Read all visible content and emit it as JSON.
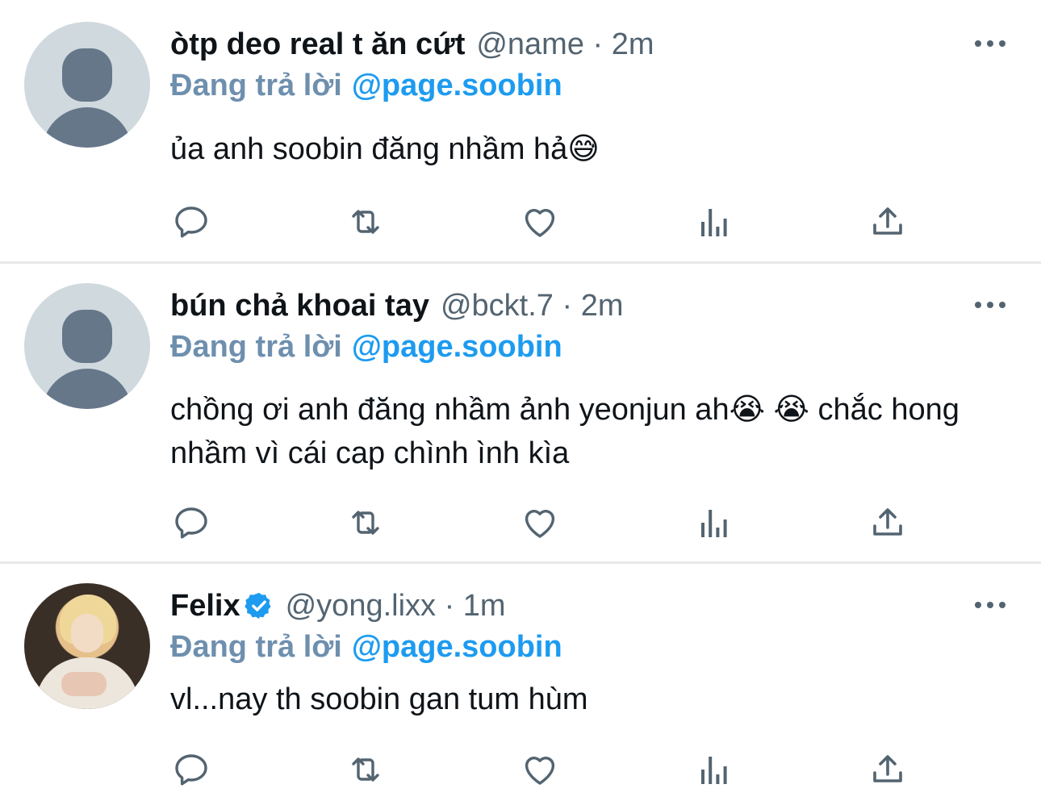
{
  "tweets": [
    {
      "display_name": "òtp deo real t ăn cứt",
      "meta": "@name · 2m",
      "reply_prefix": "Đang trả lời",
      "reply_target": "@page.soobin",
      "text": "ủa anh soobin đăng nhầm hả😅",
      "avatar": "default-avatar-icon",
      "verified": false
    },
    {
      "display_name": "bún chả khoai tay",
      "meta": "@bckt.7 · 2m",
      "reply_prefix": "Đang trả lời",
      "reply_target": "@page.soobin",
      "text": "chồng ơi anh đăng nhầm ảnh yeonjun ah😭 😭  chắc hong nhầm vì cái cap chình ình kìa",
      "avatar": "default-avatar-icon",
      "verified": false
    },
    {
      "display_name": "Felix",
      "meta": "@yong.lixx · 1m",
      "reply_prefix": "Đang trả lời",
      "reply_target": "@page.soobin",
      "text": "vl...nay th soobin gan tum hùm",
      "avatar": "profile-photo",
      "verified": true
    }
  ],
  "actions": [
    "reply-icon",
    "retweet-icon",
    "like-icon",
    "analytics-icon",
    "share-icon"
  ],
  "colors": {
    "text": "#0f1419",
    "secondary": "#536471",
    "accent": "#1d9bf0",
    "reply_prefix": "#6e8fae",
    "divider": "#e7e9ea"
  }
}
